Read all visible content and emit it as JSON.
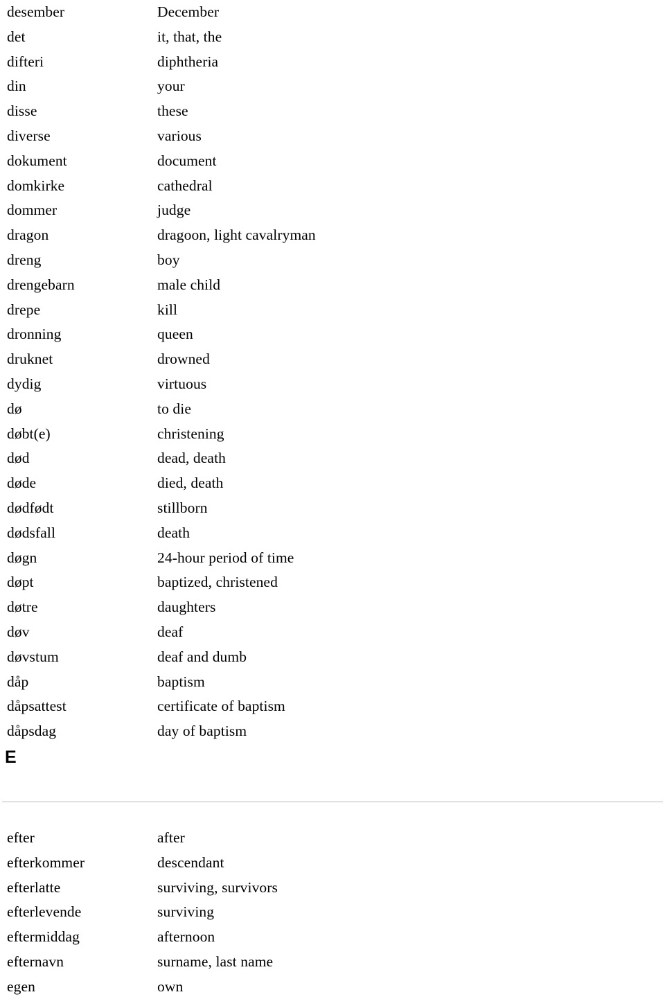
{
  "document": {
    "type": "glossary",
    "source_language": "Norwegian",
    "target_language": "English"
  },
  "sections": [
    {
      "letter": "",
      "heading_visible": false,
      "entries": [
        {
          "term": "desember",
          "definition": "December"
        },
        {
          "term": "det",
          "definition": "it, that, the"
        },
        {
          "term": "difteri",
          "definition": "diphtheria"
        },
        {
          "term": "din",
          "definition": "your"
        },
        {
          "term": "disse",
          "definition": "these"
        },
        {
          "term": "diverse",
          "definition": "various"
        },
        {
          "term": "dokument",
          "definition": "document"
        },
        {
          "term": "domkirke",
          "definition": "cathedral"
        },
        {
          "term": "dommer",
          "definition": "judge"
        },
        {
          "term": "dragon",
          "definition": "dragoon, light cavalryman"
        },
        {
          "term": "dreng",
          "definition": "boy"
        },
        {
          "term": "drengebarn",
          "definition": "male child"
        },
        {
          "term": "drepe",
          "definition": "kill"
        },
        {
          "term": "dronning",
          "definition": "queen"
        },
        {
          "term": "druknet",
          "definition": "drowned"
        },
        {
          "term": "dydig",
          "definition": "virtuous"
        },
        {
          "term": "dø",
          "definition": "to die"
        },
        {
          "term": "døbt(e)",
          "definition": "christening"
        },
        {
          "term": "død",
          "definition": "dead, death"
        },
        {
          "term": "døde",
          "definition": "died, death"
        },
        {
          "term": "dødfødt",
          "definition": "stillborn"
        },
        {
          "term": "dødsfall",
          "definition": "death"
        },
        {
          "term": "døgn",
          "definition": "24-hour period of time"
        },
        {
          "term": "døpt",
          "definition": "baptized, christened"
        },
        {
          "term": "døtre",
          "definition": "daughters"
        },
        {
          "term": "døv",
          "definition": "deaf"
        },
        {
          "term": "døvstum",
          "definition": "deaf and dumb"
        },
        {
          "term": "dåp",
          "definition": "baptism"
        },
        {
          "term": "dåpsattest",
          "definition": "certificate of baptism"
        },
        {
          "term": "dåpsdag",
          "definition": "day of baptism"
        }
      ]
    },
    {
      "letter": "E",
      "heading_visible": true,
      "entries": [
        {
          "term": "efter",
          "definition": "after"
        },
        {
          "term": "efterkommer",
          "definition": "descendant"
        },
        {
          "term": "efterlatte",
          "definition": "surviving, survivors"
        },
        {
          "term": "efterlevende",
          "definition": "surviving"
        },
        {
          "term": "eftermiddag",
          "definition": "afternoon"
        },
        {
          "term": "efternavn",
          "definition": "surname, last name"
        },
        {
          "term": "egen",
          "definition": "own"
        }
      ]
    }
  ],
  "colors": {
    "text": "#000000",
    "background": "#ffffff",
    "rule": "#b9b9b9"
  }
}
